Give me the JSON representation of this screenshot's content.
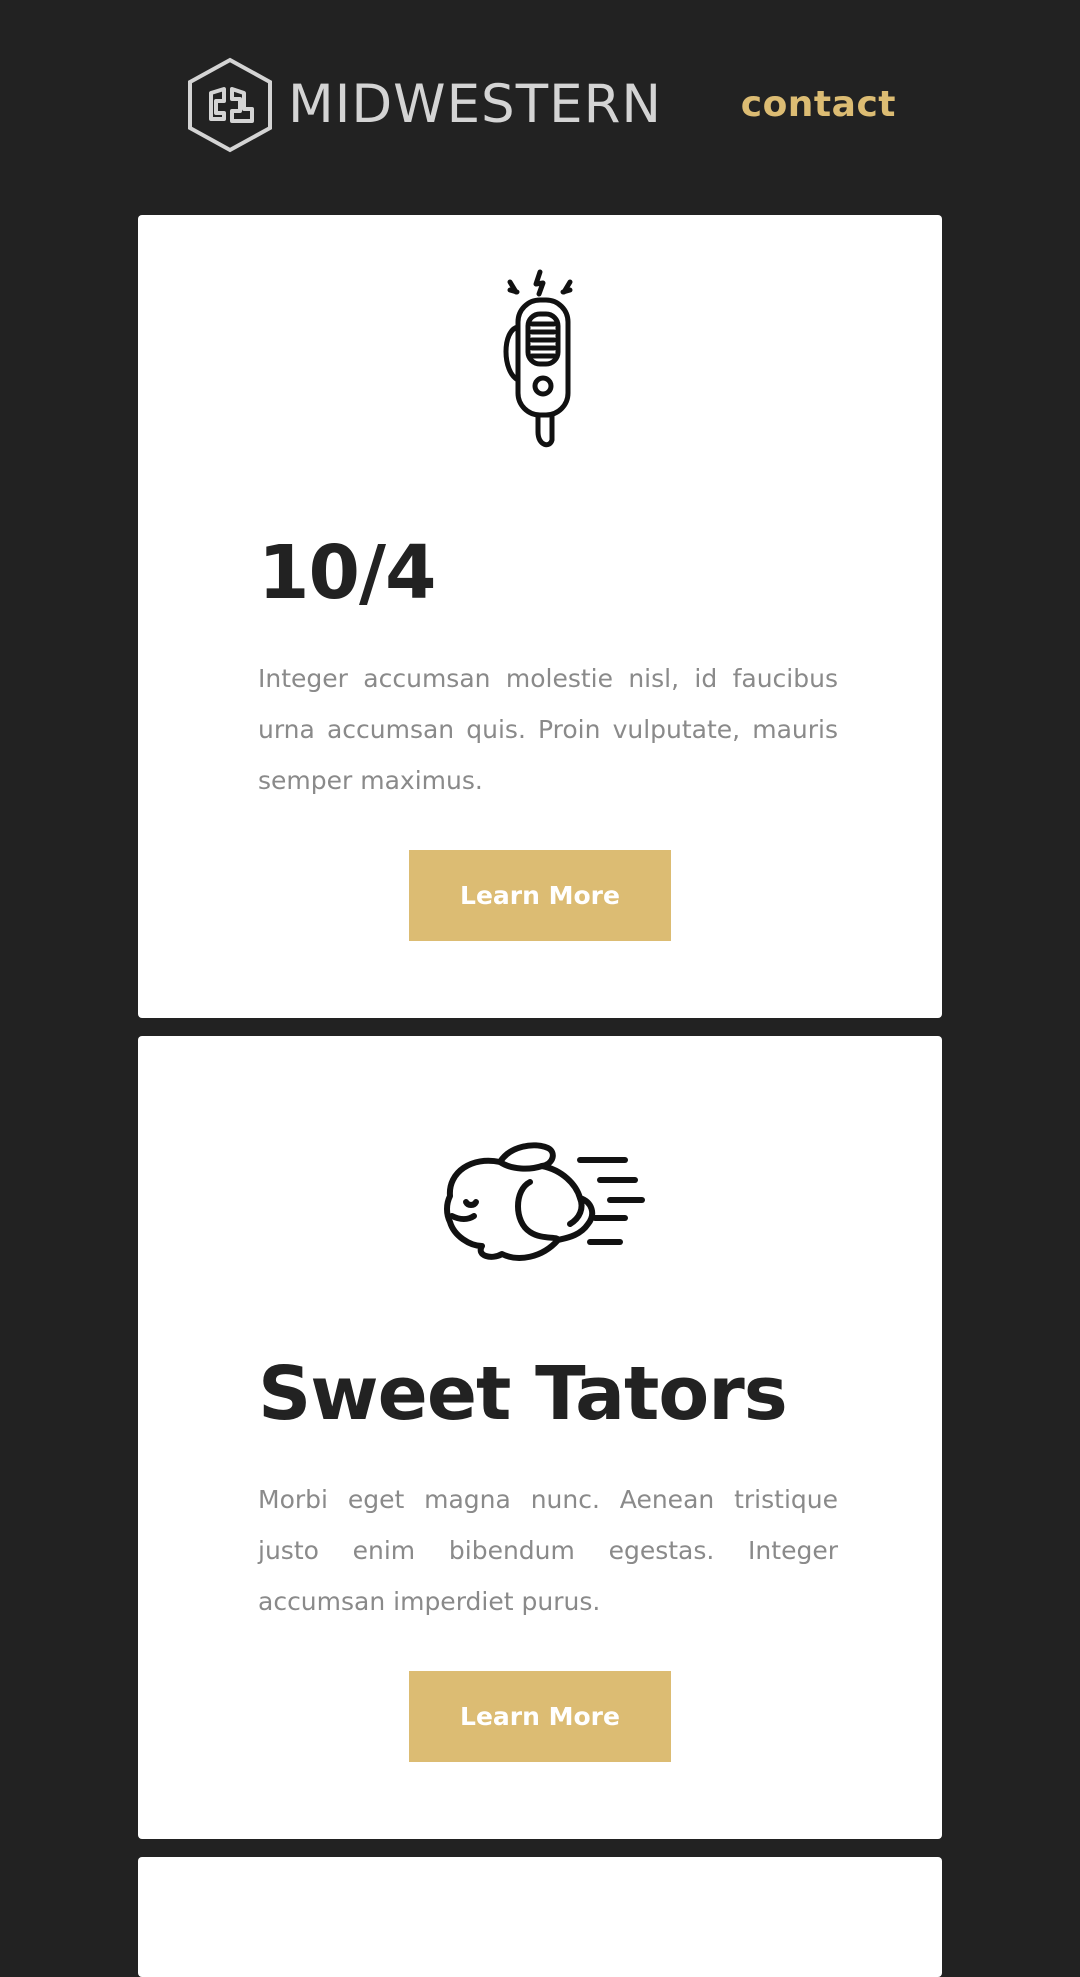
{
  "header": {
    "brand_name": "MIDWESTERN",
    "contact_label": "contact"
  },
  "colors": {
    "background": "#222222",
    "card": "#ffffff",
    "accent": "#dcbc73",
    "heading": "#222222",
    "body_text": "#8a8a8a"
  },
  "cards": [
    {
      "icon": "radio-microphone-icon",
      "title": "10/4",
      "text": "Integer accumsan molestie nisl, id faucibus urna accumsan quis. Proin vulputate, mauris semper maximus.",
      "button_label": "Learn More"
    },
    {
      "icon": "running-rabbit-icon",
      "title": "Sweet Tators",
      "text": "Morbi eget magna nunc. Aenean tristique justo enim bibendum egestas. Integer accumsan imperdiet purus.",
      "button_label": "Learn More"
    }
  ]
}
